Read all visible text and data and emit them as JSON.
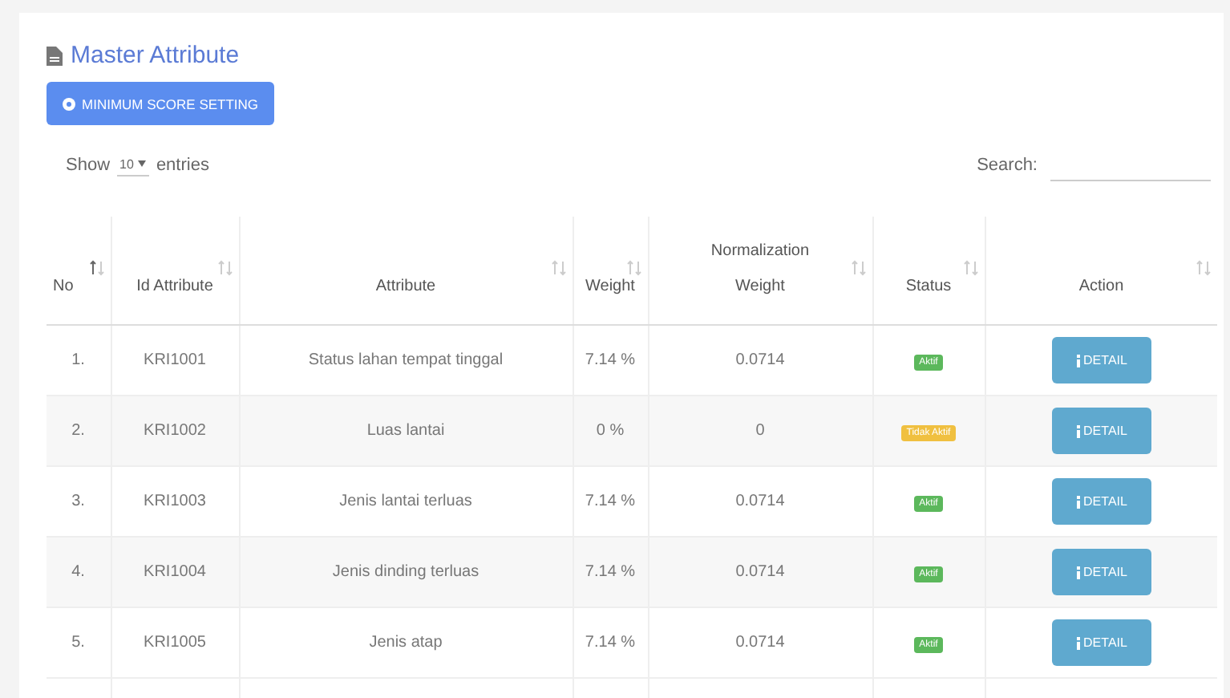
{
  "title": "Master Attribute",
  "button": "MINIMUM SCORE SETTING",
  "length": {
    "prefix": "Show",
    "value": "10",
    "suffix": "entries"
  },
  "search": {
    "label": "Search:"
  },
  "table": {
    "columns": [
      {
        "label": "No",
        "sorted": true
      },
      {
        "label": "Id Attribute",
        "sorted": false
      },
      {
        "label": "Attribute",
        "sorted": false
      },
      {
        "label": "Weight",
        "sorted": false
      },
      {
        "label": "Normalization Weight",
        "sorted": false
      },
      {
        "label": "Status",
        "sorted": false
      },
      {
        "label": "Action",
        "sorted": false
      }
    ],
    "rows": [
      {
        "no": "1.",
        "id": "KRI1001",
        "attribute": "Status lahan tempat tinggal",
        "weight": "7.14 %",
        "norm": "0.0714",
        "status": "Aktif",
        "color": "#5cb85c",
        "action": "DETAIL"
      },
      {
        "no": "2.",
        "id": "KRI1002",
        "attribute": "Luas lantai",
        "weight": "0 %",
        "norm": "0",
        "status": "Tidak Aktif",
        "color": "#f0c040",
        "action": "DETAIL"
      },
      {
        "no": "3.",
        "id": "KRI1003",
        "attribute": "Jenis lantai terluas",
        "weight": "7.14 %",
        "norm": "0.0714",
        "status": "Aktif",
        "color": "#5cb85c",
        "action": "DETAIL"
      },
      {
        "no": "4.",
        "id": "KRI1004",
        "attribute": "Jenis dinding terluas",
        "weight": "7.14 %",
        "norm": "0.0714",
        "status": "Aktif",
        "color": "#5cb85c",
        "action": "DETAIL"
      },
      {
        "no": "5.",
        "id": "KRI1005",
        "attribute": "Jenis atap",
        "weight": "7.14 %",
        "norm": "0.0714",
        "status": "Aktif",
        "color": "#5cb85c",
        "action": "DETAIL"
      }
    ]
  }
}
